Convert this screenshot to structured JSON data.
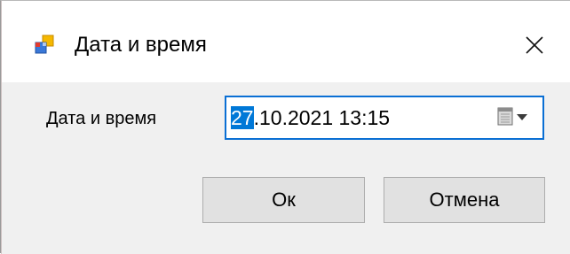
{
  "window": {
    "title": "Дата и время",
    "icon": "app-window-icon",
    "close_glyph": "✕"
  },
  "form": {
    "datetime_label": "Дата и время",
    "datetime_value_selected": "27",
    "datetime_value_rest": ".10.2021 13:15",
    "calendar_icon": "calendar-icon",
    "dropdown_icon": "chevron-down-icon"
  },
  "buttons": {
    "ok_label": "Ок",
    "cancel_label": "Отмена"
  },
  "colors": {
    "accent": "#0078d7",
    "focus_border": "#0a6fd4",
    "button_bg": "#e1e1e1",
    "dialog_bg": "#f0f0f0"
  }
}
